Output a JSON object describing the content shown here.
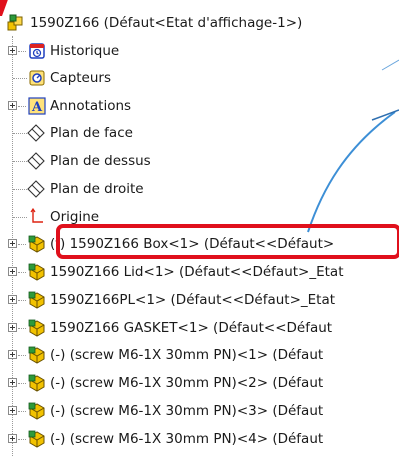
{
  "tree": {
    "root": {
      "label": "1590Z166  (Défaut<Etat d'affichage-1>)",
      "icon": "assembly-icon"
    },
    "items": [
      {
        "label": "Historique",
        "icon": "history-icon",
        "expandable": true
      },
      {
        "label": "Capteurs",
        "icon": "sensor-icon",
        "expandable": false
      },
      {
        "label": "Annotations",
        "icon": "annotation-icon",
        "expandable": true
      },
      {
        "label": "Plan de face",
        "icon": "plane-icon",
        "expandable": false
      },
      {
        "label": "Plan de dessus",
        "icon": "plane-icon",
        "expandable": false
      },
      {
        "label": "Plan de droite",
        "icon": "plane-icon",
        "expandable": false
      },
      {
        "label": "Origine",
        "icon": "origin-icon",
        "expandable": false
      },
      {
        "label": "(f) 1590Z166 Box<1> (Défaut<<Défaut>",
        "icon": "part-icon",
        "expandable": true
      },
      {
        "label": "1590Z166 Lid<1> (Défaut<<Défaut>_Etat",
        "icon": "part-icon",
        "expandable": true
      },
      {
        "label": "1590Z166PL<1> (Défaut<<Défaut>_Etat",
        "icon": "part-icon",
        "expandable": true
      },
      {
        "label": "1590Z166 GASKET<1> (Défaut<<Défaut",
        "icon": "part-icon",
        "expandable": true
      },
      {
        "label": "(-) (screw M6-1X 30mm PN)<1> (Défaut",
        "icon": "part-icon",
        "expandable": true
      },
      {
        "label": "(-) (screw M6-1X 30mm PN)<2> (Défaut",
        "icon": "part-icon",
        "expandable": true
      },
      {
        "label": "(-) (screw M6-1X 30mm PN)<3> (Défaut",
        "icon": "part-icon",
        "expandable": true
      },
      {
        "label": "(-) (screw M6-1X 30mm PN)<4> (Défaut",
        "icon": "part-icon",
        "expandable": true
      }
    ]
  },
  "colors": {
    "highlight": "#e0101c",
    "part_yellow": "#f2c200",
    "part_green": "#2e9a3a",
    "annotation_blue": "#1f3fbf",
    "background_curve": "#3d8fd6"
  }
}
